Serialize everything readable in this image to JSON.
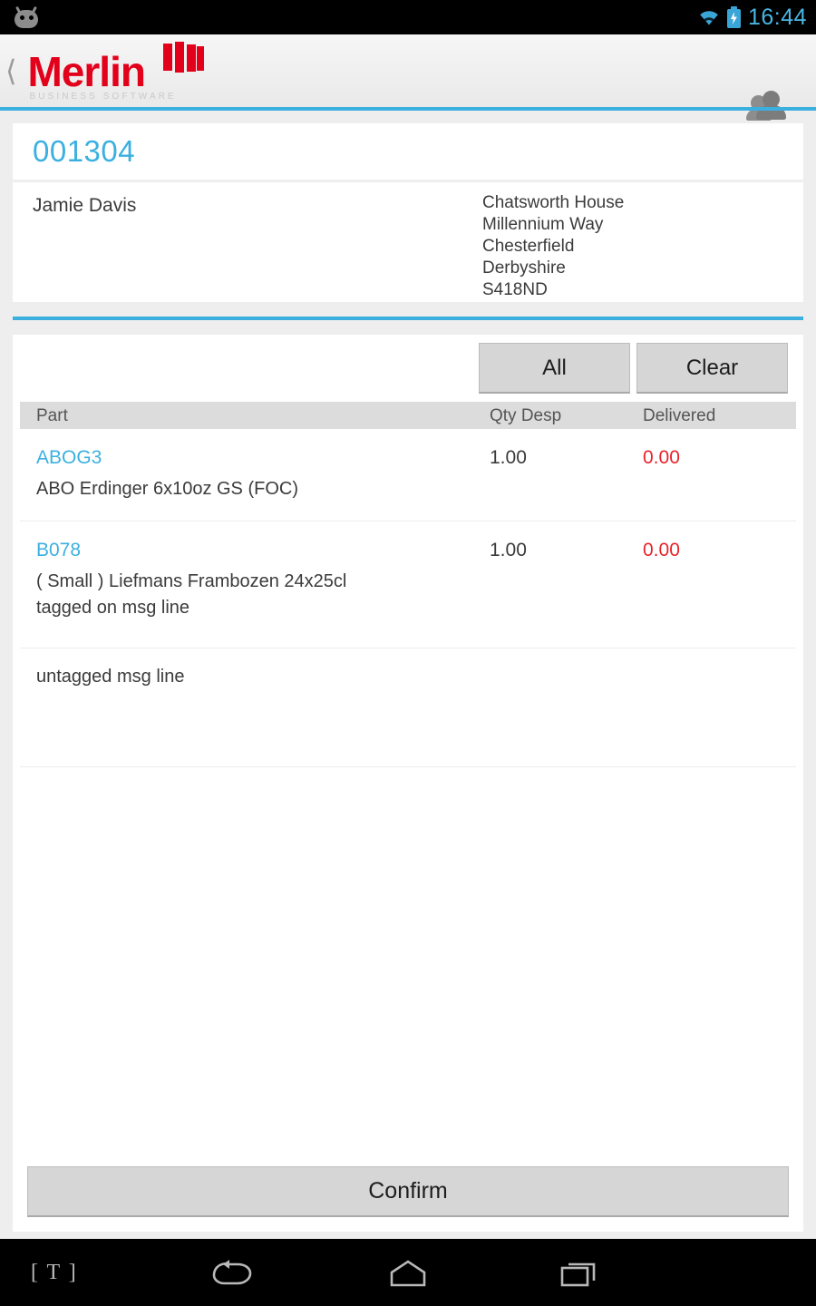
{
  "status_bar": {
    "notification_icon": "android-head-icon",
    "wifi_icon": "wifi-icon",
    "battery_icon": "battery-charging-icon",
    "time": "16:44",
    "accent_color": "#49b6e4"
  },
  "app_bar": {
    "back_icon": "back-chevron-icon",
    "logo_text": "Merlin",
    "logo_tagline": "BUSINESS SOFTWARE",
    "logo_color": "#e2001a",
    "contacts_icon": "people-icon"
  },
  "theme": {
    "accent_teal": "#3bb0e0",
    "page_background": "#eeeeee",
    "card_background": "#ffffff",
    "danger_red": "#e8232a"
  },
  "order": {
    "number": "001304",
    "customer_name": "Jamie Davis",
    "address_lines": [
      "Chatsworth House",
      "Millennium Way",
      "Chesterfield",
      "Derbyshire",
      "S418ND"
    ],
    "address_text": "Chatsworth House\nMillennium Way\nChesterfield\nDerbyshire\nS418ND"
  },
  "toolbar": {
    "all_label": "All",
    "clear_label": "Clear"
  },
  "table": {
    "headers": {
      "part": "Part",
      "qty_desp": "Qty Desp",
      "delivered": "Delivered"
    },
    "rows": [
      {
        "type": "part",
        "code": "ABOG3",
        "description": "ABO Erdinger 6x10oz GS (FOC)",
        "qty_desp": "1.00",
        "delivered": "0.00"
      },
      {
        "type": "part",
        "code": "B078",
        "description": "( Small )  Liefmans Frambozen 24x25cl\ntagged on msg line",
        "description_line1": "( Small )  Liefmans Frambozen 24x25cl",
        "description_line2": "tagged on msg line",
        "qty_desp": "1.00",
        "delivered": "0.00"
      },
      {
        "type": "message",
        "message": "untagged msg line"
      }
    ]
  },
  "footer": {
    "confirm_label": "Confirm"
  },
  "nav_bar": {
    "text_badge": "[ T ]",
    "back_icon": "back-arrow-icon",
    "home_icon": "home-icon",
    "recents_icon": "recent-apps-icon"
  }
}
